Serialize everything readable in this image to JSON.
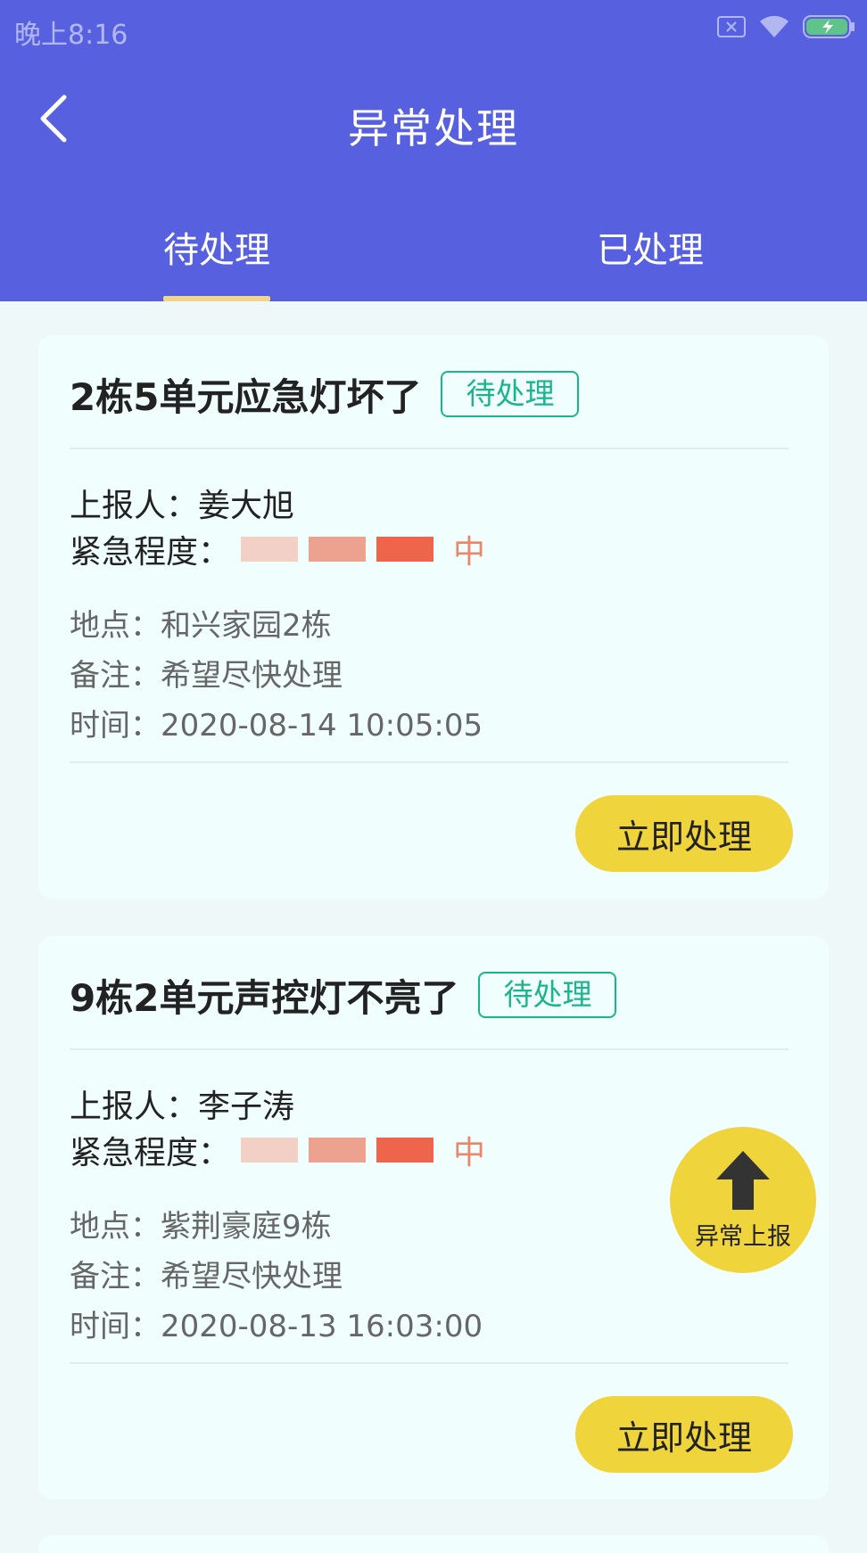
{
  "status_bar": {
    "time": "晚上8:16"
  },
  "nav": {
    "title": "异常处理",
    "back_icon": "chevron-left-icon"
  },
  "tabs": [
    {
      "label": "待处理",
      "active": true
    },
    {
      "label": "已处理",
      "active": false
    }
  ],
  "colors": {
    "header": "#5761e0",
    "tab_indicator": "#f2d58a",
    "badge": "#1bb48c",
    "button": "#f0d43c",
    "urgency_low": "#f3d0c5",
    "urgency_mid": "#eda290",
    "urgency_high": "#ee654c"
  },
  "cards": [
    {
      "title": "2栋5单元应急灯坏了",
      "status": "待处理",
      "reporter_label": "上报人：",
      "reporter": "姜大旭",
      "urgency_label": "紧急程度：",
      "urgency_level": "中",
      "location_label": "地点：",
      "location": "和兴家园2栋",
      "note_label": "备注：",
      "note": "希望尽快处理",
      "time_label": "时间：",
      "time": "2020-08-14 10:05:05",
      "action": "立即处理"
    },
    {
      "title": "9栋2单元声控灯不亮了",
      "status": "待处理",
      "reporter_label": "上报人：",
      "reporter": "李子涛",
      "urgency_label": "紧急程度：",
      "urgency_level": "中",
      "location_label": "地点：",
      "location": "紫荆豪庭9栋",
      "note_label": "备注：",
      "note": "希望尽快处理",
      "time_label": "时间：",
      "time": "2020-08-13 16:03:00",
      "action": "立即处理"
    }
  ],
  "fab": {
    "label": "异常上报",
    "icon": "arrow-up-icon"
  }
}
